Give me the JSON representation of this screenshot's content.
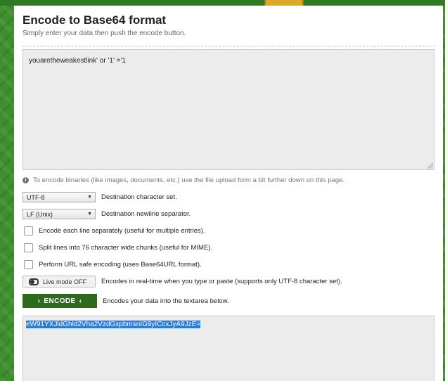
{
  "page": {
    "title": "Encode to Base64 format",
    "subtitle": "Simply enter your data then push the encode button."
  },
  "input": {
    "value": "youaretheweakestlink' or '1' ='1"
  },
  "info": {
    "icon": "info-icon",
    "text": "To encode binaries (like images, documents, etc.) use the file upload form a bit further down on this page."
  },
  "options": {
    "charset": {
      "selected": "UTF-8",
      "label": "Destination character set."
    },
    "newline": {
      "selected": "LF (Unix)",
      "label": "Destination newline separator."
    },
    "each_line": {
      "label": "Encode each line separately (useful for multiple entries)."
    },
    "split_lines": {
      "label": "Split lines into 76 character wide chunks (useful for MIME)."
    },
    "url_safe": {
      "label": "Perform URL safe encoding (uses Base64URL format)."
    },
    "live_mode": {
      "button": "Live mode OFF",
      "label": "Encodes in real-time when you type or paste (supports only UTF-8 character set)."
    }
  },
  "encode": {
    "button": "ENCODE",
    "label": "Encodes your data into the textarea below."
  },
  "output": {
    "value": "eW91YXJldGhld2Vha2VzdGxpbmsnIG9yICcxJyA9JzE="
  },
  "colors": {
    "accent": "#2d6a1e",
    "selection": "#2f7ad6",
    "background": "#3f8f2f"
  }
}
